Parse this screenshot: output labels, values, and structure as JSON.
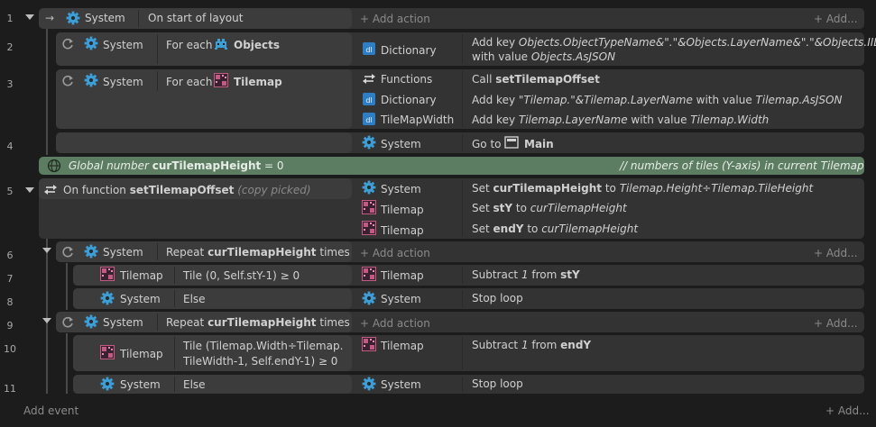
{
  "line_numbers": [
    "1",
    "2",
    "3",
    "4",
    "5",
    "6",
    "7",
    "8",
    "9",
    "10",
    "11"
  ],
  "common": {
    "system": "System",
    "tilemap": "Tilemap",
    "dictionary": "Dictionary",
    "functions": "Functions",
    "tilemapwidth": "TileMapWidth",
    "add_action": "+ Add action",
    "add_more": "+ Add...",
    "for_each": "For each",
    "else": "Else"
  },
  "e1": {
    "condition": "On start of layout"
  },
  "e2": {
    "object": "Objects",
    "action_l1a": "Add key ",
    "action_l1b": "Objects.ObjectTypeName&\".\"&Objects.LayerName&\".\"&Objects.IID",
    "action_l2a": "with value ",
    "action_l2b": "Objects.AsJSON"
  },
  "e3": {
    "object": "Tilemap",
    "a1a": "Call ",
    "a1b": "setTilemapOffset",
    "a2a": "Add key ",
    "a2b": "\"Tilemap.\"&Tilemap.LayerName",
    "a2c": " with value ",
    "a2d": "Tilemap.AsJSON",
    "a3a": "Add key ",
    "a3b": "Tilemap.LayerName",
    "a3c": " with value ",
    "a3d": "Tilemap.Width"
  },
  "e4": {
    "a1a": "Go to ",
    "a1b": "Main"
  },
  "global": {
    "pre": "Global number ",
    "name": "curTilemapHeight",
    "post": " = 0",
    "comment": "//  numbers of tiles (Y-axis) in current Tilemap"
  },
  "e5": {
    "pre": "On function ",
    "name": "setTilemapOffset",
    "note": " (copy picked)",
    "a1a": "Set ",
    "a1b": "curTilemapHeight",
    "a1c": " to ",
    "a1d": "Tilemap.Height÷Tilemap.TileHeight",
    "a2a": "Set ",
    "a2b": "stY",
    "a2c": " to ",
    "a2d": "curTilemapHeight",
    "a3a": "Set ",
    "a3b": "endY",
    "a3c": " to ",
    "a3d": "curTilemapHeight"
  },
  "e6": {
    "pre": "Repeat ",
    "name": "curTilemapHeight",
    "post": " times"
  },
  "e7": {
    "cond": "Tile (0, Self.stY-1) ≥ 0",
    "a1a": "Subtract ",
    "a1b": "1",
    "a1c": " from ",
    "a1d": "stY"
  },
  "e8": {
    "a1": "Stop loop"
  },
  "e9": {
    "pre": "Repeat ",
    "name": "curTilemapHeight",
    "post": " times"
  },
  "e10": {
    "cond_l1": "Tile (Tilemap.Width÷Tilemap.",
    "cond_l2": "TileWidth-1, Self.endY-1) ≥ 0",
    "a1a": "Subtract ",
    "a1b": "1",
    "a1c": " from ",
    "a1d": "endY"
  },
  "e11": {
    "a1": "Stop loop"
  },
  "footer": {
    "add_event": "Add event",
    "add_more": "+ Add..."
  },
  "colors": {
    "background": "#1c1c1c",
    "block": "#333333",
    "condition_block": "#3c3c3c",
    "global_bar": "#5d7d62",
    "gear": "#3d9fd8",
    "tilemap_icon": "#c25a82",
    "dictionary_icon": "#2f7ec4"
  }
}
